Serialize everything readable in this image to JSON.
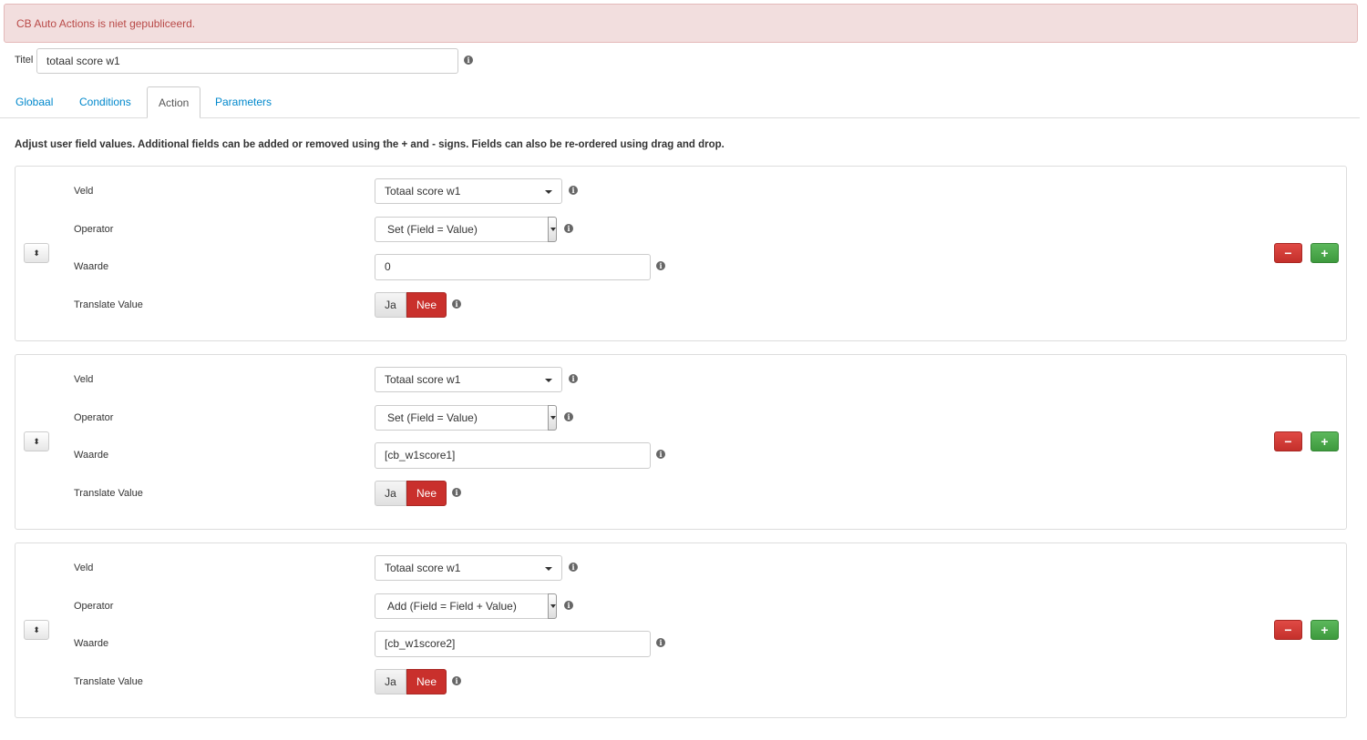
{
  "alert": {
    "text": "CB Auto Actions is niet gepubliceerd."
  },
  "title": {
    "label": "Titel",
    "value": "totaal score w1"
  },
  "tabs": [
    {
      "label": "Globaal",
      "active": false
    },
    {
      "label": "Conditions",
      "active": false
    },
    {
      "label": "Action",
      "active": true
    },
    {
      "label": "Parameters",
      "active": false
    }
  ],
  "description": "Adjust user field values. Additional fields can be added or removed using the + and - signs. Fields can also be re-ordered using drag and drop.",
  "labels": {
    "veld": "Veld",
    "operator": "Operator",
    "waarde": "Waarde",
    "translate": "Translate Value",
    "ja": "Ja",
    "nee": "Nee",
    "remove": "−",
    "add": "+",
    "info": "i",
    "drag": "⬍"
  },
  "rows": [
    {
      "veld": "Totaal score w1",
      "operator": "Set (Field = Value)",
      "waarde": "0",
      "translate": "Nee"
    },
    {
      "veld": "Totaal score w1",
      "operator": "Set (Field = Value)",
      "waarde": "[cb_w1score1]",
      "translate": "Nee"
    },
    {
      "veld": "Totaal score w1",
      "operator": "Add (Field = Field + Value)",
      "waarde": "[cb_w1score2]",
      "translate": "Nee"
    }
  ],
  "colors": {
    "alert_bg": "#f2dede",
    "alert_text": "#b94a48",
    "link": "#0088cc",
    "danger": "#c9302c",
    "success": "#5cb85c"
  }
}
